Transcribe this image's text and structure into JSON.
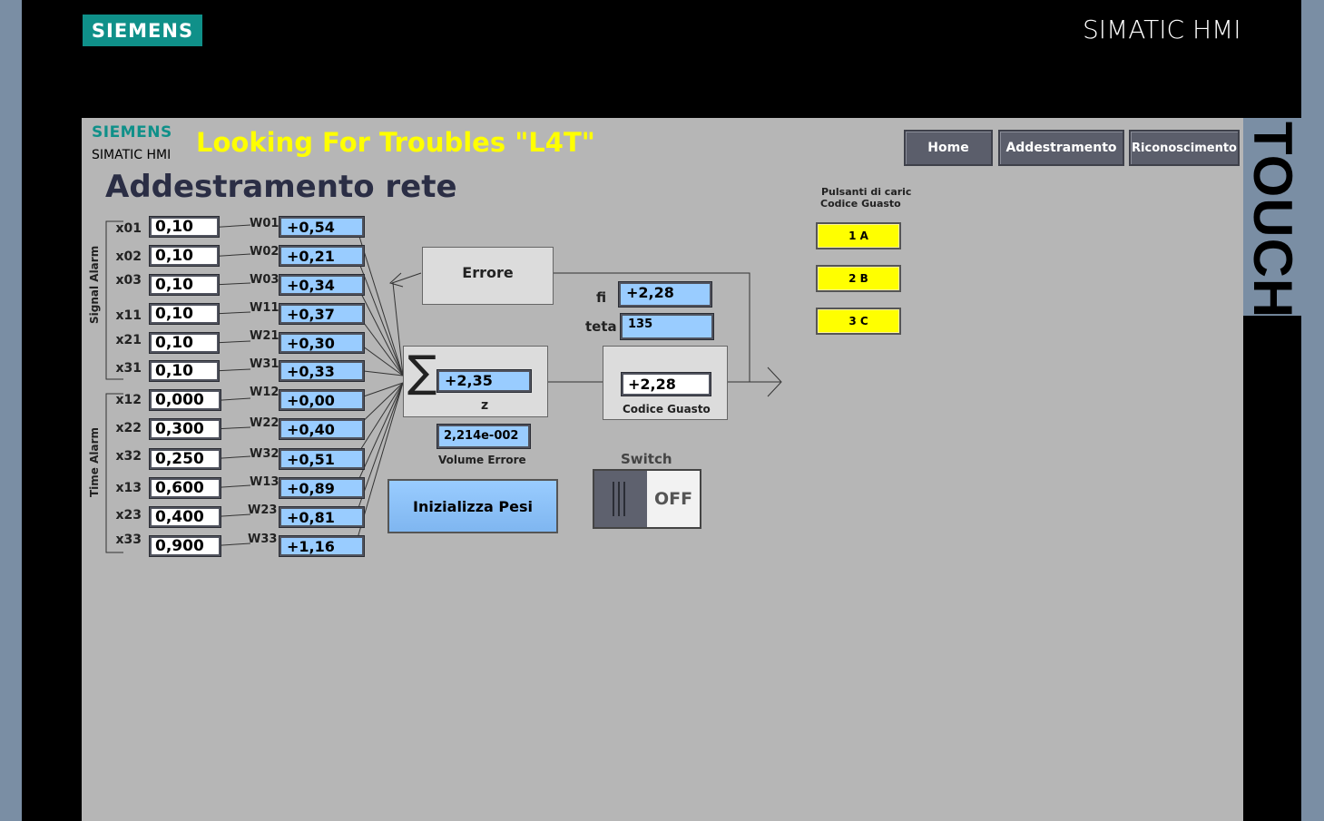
{
  "header": {
    "brand_logo": "SIEMENS",
    "product": "SIMATIC HMI",
    "side_label": "TOUCH"
  },
  "screen": {
    "small_brand": "SIEMENS",
    "small_product": "SIMATIC HMI",
    "banner": "Looking For Troubles \"L4T\"",
    "page_title": "Addestramento rete",
    "nav": {
      "home": "Home",
      "training": "Addestramento",
      "recognition": "Riconoscimento"
    },
    "group_signal": "Signal Alarm",
    "group_time": "Time Alarm",
    "inputs": [
      {
        "x_label": "x01",
        "x_value": "0,10",
        "w_label": "W01",
        "w_value": "+0,54"
      },
      {
        "x_label": "x02",
        "x_value": "0,10",
        "w_label": "W02",
        "w_value": "+0,21"
      },
      {
        "x_label": "x03",
        "x_value": "0,10",
        "w_label": "W03",
        "w_value": "+0,34"
      },
      {
        "x_label": "x11",
        "x_value": "0,10",
        "w_label": "W11",
        "w_value": "+0,37"
      },
      {
        "x_label": "x21",
        "x_value": "0,10",
        "w_label": "W21",
        "w_value": "+0,30"
      },
      {
        "x_label": "x31",
        "x_value": "0,10",
        "w_label": "W31",
        "w_value": "+0,33"
      },
      {
        "x_label": "x12",
        "x_value": "0,000",
        "w_label": "W12",
        "w_value": "+0,00"
      },
      {
        "x_label": "x22",
        "x_value": "0,300",
        "w_label": "W22",
        "w_value": "+0,40"
      },
      {
        "x_label": "x32",
        "x_value": "0,250",
        "w_label": "W32",
        "w_value": "+0,51"
      },
      {
        "x_label": "x13",
        "x_value": "0,600",
        "w_label": "W13",
        "w_value": "+0,89"
      },
      {
        "x_label": "x23",
        "x_value": "0,400",
        "w_label": "W23",
        "w_value": "+0,81"
      },
      {
        "x_label": "x33",
        "x_value": "0,900",
        "w_label": "W33",
        "w_value": "+1,16"
      }
    ],
    "error_label": "Errore",
    "sum_symbol": "∑",
    "sum_value": "+2,35",
    "sum_label": "z",
    "volume_value": "2,214e-002",
    "volume_label": "Volume Errore",
    "fi_label": "fi",
    "fi_value": "+2,28",
    "teta_label": "teta",
    "teta_value": "135",
    "code_value": "+2,28",
    "code_label": "Codice Guasto",
    "init_button": "Inizializza Pesi",
    "switch_label": "Switch",
    "switch_state": "OFF",
    "load_title_1": "Pulsanti di carica",
    "load_title_2": "Codice Guasto",
    "load_buttons": [
      "1 A",
      "2 B",
      "3 C"
    ]
  },
  "colors": {
    "brand": "#0f9089",
    "banner": "#ffff00",
    "screen_bg": "#b6b6b6",
    "value_field": "#99ccff",
    "title": "#2b2e45"
  }
}
